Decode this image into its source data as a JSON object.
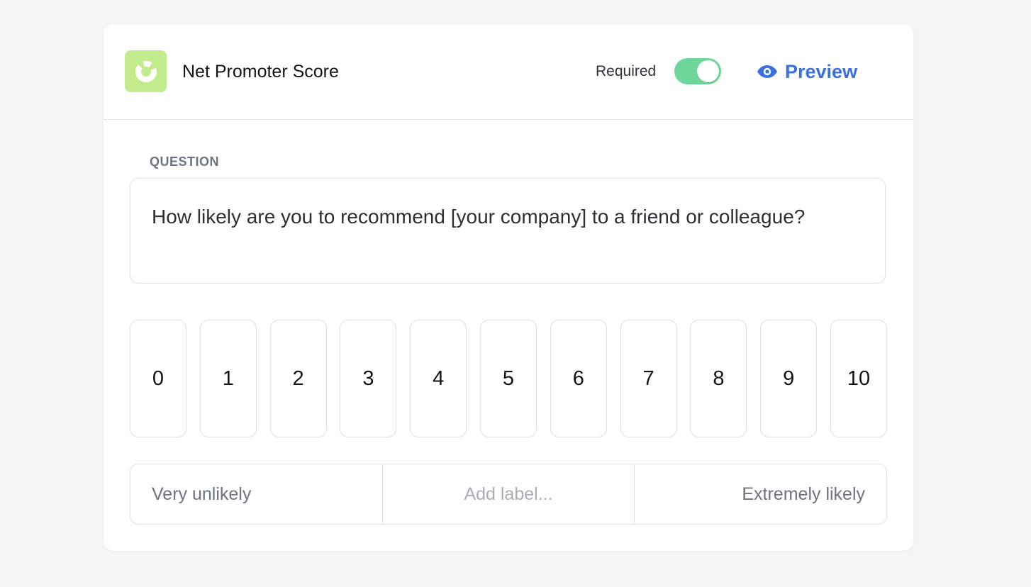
{
  "header": {
    "logo_icon": "donut-chart-icon",
    "title": "Net Promoter Score",
    "required_label": "Required",
    "required_on": true,
    "preview_label": "Preview",
    "preview_icon": "eye-icon"
  },
  "question": {
    "section_label": "QUESTION",
    "text": "How likely are you to recommend [your company] to a friend or colleague?"
  },
  "scale": {
    "values": [
      "0",
      "1",
      "2",
      "3",
      "4",
      "5",
      "6",
      "7",
      "8",
      "9",
      "10"
    ]
  },
  "labels": {
    "low": "Very unlikely",
    "middle_placeholder": "Add label...",
    "high": "Extremely likely"
  },
  "colors": {
    "accent": "#3b6fe0",
    "toggle_on": "#6fd69b",
    "logo_bg": "#c1eb8d"
  }
}
